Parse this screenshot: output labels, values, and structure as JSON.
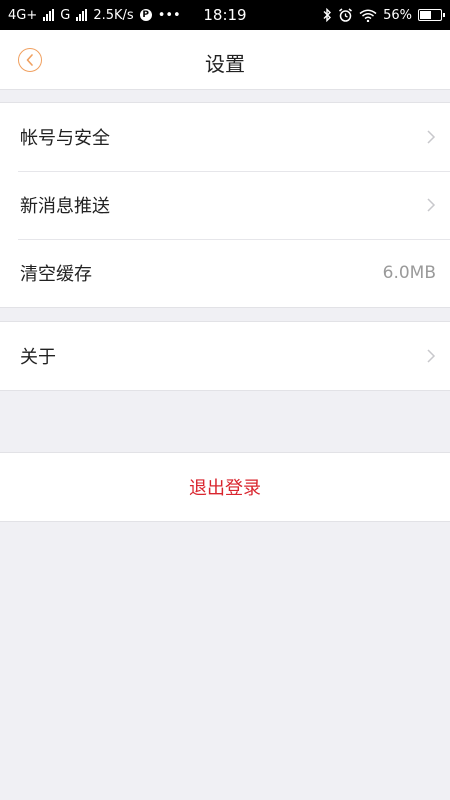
{
  "status_bar": {
    "network1": "4G+",
    "network2": "G",
    "speed": "2.5K/s",
    "more": "•••",
    "time": "18:19",
    "battery_percent": "56%",
    "battery_level": 0.56
  },
  "navbar": {
    "title": "设置"
  },
  "settings": {
    "account_security": "帐号与安全",
    "new_message_push": "新消息推送",
    "clear_cache": "清空缓存",
    "cache_size": "6.0MB",
    "about": "关于"
  },
  "logout_label": "退出登录",
  "colors": {
    "accent": "#f0a060",
    "danger": "#d9252e",
    "background": "#f0f0f4"
  }
}
